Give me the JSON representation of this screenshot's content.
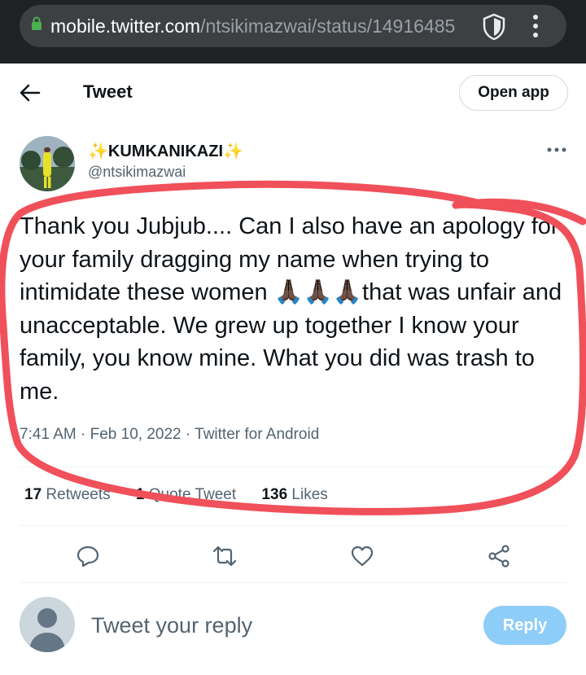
{
  "browser": {
    "url_host": "mobile.twitter.com",
    "url_path": "/ntsikimazwai/status/14916485",
    "icons": [
      "lock-icon",
      "shield-icon",
      "kebab-menu-icon"
    ]
  },
  "header": {
    "title": "Tweet",
    "open_app_label": "Open app"
  },
  "author": {
    "name_text": "KUMKANIKAZI",
    "name_emoji": "✨",
    "handle": "@ntsikimazwai"
  },
  "tweet": {
    "text": "Thank you Jubjub.... Can I also have an apology for your family dragging my name when trying to intimidate these women 🙏🏿🙏🏿🙏🏿that was unfair and unacceptable. We grew up together I know your family, you know mine. What you did was trash to me.",
    "time": "7:41 AM",
    "date": "Feb 10, 2022",
    "source": "Twitter for Android",
    "separator": "·"
  },
  "stats": {
    "retweets_count": "17",
    "retweets_label": "Retweets",
    "quotes_count": "1",
    "quotes_label": "Quote Tweet",
    "likes_count": "136",
    "likes_label": "Likes"
  },
  "reply": {
    "placeholder": "Tweet your reply",
    "button_label": "Reply"
  },
  "colors": {
    "annotation_red": "#f0505a",
    "reply_button": "#8ecdf8",
    "secondary_text": "#536471"
  }
}
